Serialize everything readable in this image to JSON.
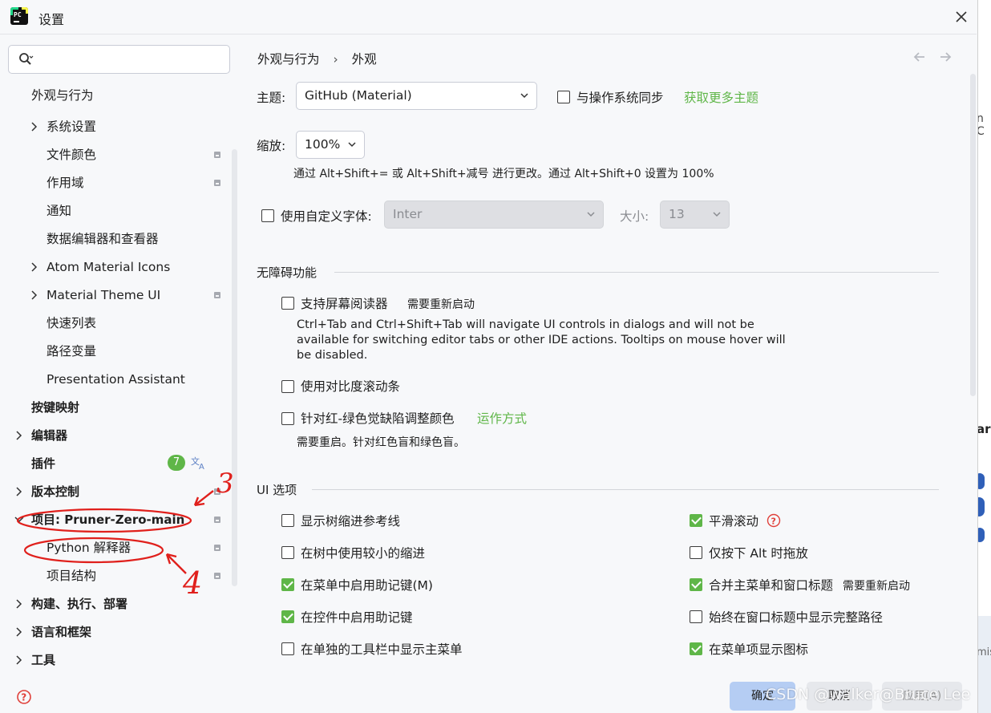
{
  "window": {
    "title": "设置",
    "close": "✕"
  },
  "search": {
    "placeholder": ""
  },
  "sidebar": {
    "items": [
      {
        "label": "外观与行为"
      },
      {
        "label": "系统设置"
      },
      {
        "label": "文件颜色"
      },
      {
        "label": "作用域"
      },
      {
        "label": "通知"
      },
      {
        "label": "数据编辑器和查看器"
      },
      {
        "label": "Atom Material Icons"
      },
      {
        "label": "Material Theme UI"
      },
      {
        "label": "快速列表"
      },
      {
        "label": "路径变量"
      },
      {
        "label": "Presentation Assistant"
      },
      {
        "label": "按键映射"
      },
      {
        "label": "编辑器"
      },
      {
        "label": "插件"
      },
      {
        "label": "版本控制"
      },
      {
        "label": "项目: Pruner-Zero-main"
      },
      {
        "label": "Python 解释器"
      },
      {
        "label": "项目结构"
      },
      {
        "label": "构建、执行、部署"
      },
      {
        "label": "语言和框架"
      },
      {
        "label": "工具"
      }
    ],
    "plugin_badge": "7"
  },
  "breadcrumb": {
    "parent": "外观与行为",
    "sep": "›",
    "current": "外观"
  },
  "theme": {
    "label": "主题:",
    "value": "GitHub (Material)",
    "sync_label": "与操作系统同步",
    "more_link": "获取更多主题"
  },
  "zoom": {
    "label": "缩放:",
    "value": "100%",
    "hint": "通过 Alt+Shift+= 或 Alt+Shift+减号 进行更改。通过 Alt+Shift+0 设置为 100%"
  },
  "font": {
    "label": "使用自定义字体:",
    "value": "Inter",
    "size_label": "大小:",
    "size_value": "13"
  },
  "accessibility": {
    "title": "无障碍功能",
    "screen_reader": "支持屏幕阅读器",
    "restart_note": "需要重新启动",
    "screen_reader_hint": "Ctrl+Tab and Ctrl+Shift+Tab will navigate UI controls in dialogs and will not be available for switching editor tabs or other IDE actions. Tooltips on mouse hover will be disabled.",
    "contrast_scrollbar": "使用对比度滚动条",
    "color_blind": "针对红-绿色觉缺陷调整颜色",
    "how_it_works": "运作方式",
    "color_blind_hint": "需要重启。针对红色盲和绿色盲。"
  },
  "ui_options": {
    "title": "UI 选项",
    "left": [
      {
        "label": "显示树缩进参考线",
        "checked": false
      },
      {
        "label": "在树中使用较小的缩进",
        "checked": false
      },
      {
        "label": "在菜单中启用助记键(M)",
        "checked": true
      },
      {
        "label": "在控件中启用助记键",
        "checked": true
      },
      {
        "label": "在单独的工具栏中显示主菜单",
        "checked": false
      }
    ],
    "right": [
      {
        "label": "平滑滚动",
        "checked": true
      },
      {
        "label": "仅按下 Alt 时拖放",
        "checked": false
      },
      {
        "label": "合并主菜单和窗口标题",
        "checked": true,
        "note": "需要重新启动"
      },
      {
        "label": "始终在窗口标题中显示完整路径",
        "checked": false
      },
      {
        "label": "在菜单项显示图标",
        "checked": true
      }
    ]
  },
  "buttons": {
    "ok": "确定",
    "cancel": "取消",
    "apply": "应用(A)"
  },
  "annotations": {
    "num3": "3",
    "num4": "4"
  },
  "watermark": "CSDN @walker@Bruce Lee",
  "background_window": {
    "text1": "n C",
    "text2": "are",
    "text3": "mis"
  },
  "colors": {
    "accent_green": "#5fb648",
    "ok_button": "#b5cdf3",
    "annotation_red": "#e0201c"
  }
}
